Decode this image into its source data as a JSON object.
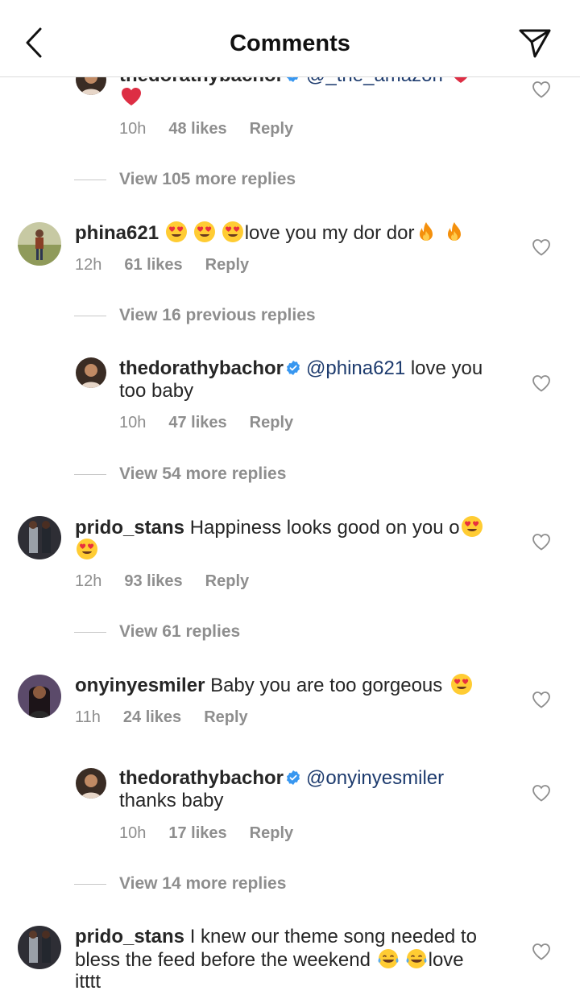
{
  "header": {
    "title": "Comments",
    "back_icon": "chevron-left-icon",
    "send_icon": "paper-plane-icon"
  },
  "comments": [
    {
      "kind": "reply",
      "username": "thedorathybachor",
      "verified": true,
      "mention": "@_the_amazon",
      "text": "",
      "time": "10h",
      "likes": "48 likes",
      "reply": "Reply",
      "emojis": [
        "red-heart"
      ],
      "partially_hidden": true
    },
    {
      "kind": "view",
      "label": "View 105 more replies"
    },
    {
      "kind": "comment",
      "username": "phina621",
      "text": "love you my dor dor",
      "time": "12h",
      "likes": "61 likes",
      "reply": "Reply",
      "emojis_before": [
        "heart-eyes",
        "heart-eyes",
        "heart-eyes"
      ],
      "emojis_after": [
        "fire",
        "fire"
      ]
    },
    {
      "kind": "view",
      "label": "View 16 previous replies"
    },
    {
      "kind": "reply",
      "username": "thedorathybachor",
      "verified": true,
      "mention": "@phina621",
      "text_line1": "love you",
      "text_line2": "too baby",
      "time": "10h",
      "likes": "47 likes",
      "reply": "Reply"
    },
    {
      "kind": "view",
      "label": "View 54 more replies"
    },
    {
      "kind": "comment",
      "username": "prido_stans",
      "text": "Happiness looks good on you o",
      "time": "12h",
      "likes": "93 likes",
      "reply": "Reply",
      "emojis_after": [
        "heart-eyes",
        "heart-eyes"
      ]
    },
    {
      "kind": "view",
      "label": "View 61 replies"
    },
    {
      "kind": "comment",
      "username": "onyinyesmiler",
      "text": "Baby you are too gorgeous",
      "time": "11h",
      "likes": "24 likes",
      "reply": "Reply",
      "emojis_after": [
        "heart-eyes"
      ]
    },
    {
      "kind": "reply",
      "username": "thedorathybachor",
      "verified": true,
      "mention": "@onyinyesmiler",
      "text": "thanks baby",
      "time": "10h",
      "likes": "17 likes",
      "reply": "Reply"
    },
    {
      "kind": "view",
      "label": "View 14 more replies"
    },
    {
      "kind": "comment",
      "username": "prido_stans",
      "text_line1": "I knew our theme song needed to",
      "text_line2": "bless the feed before the weekend",
      "text_after_emoji": "love",
      "text_line3": "itttt",
      "emojis_inline": [
        "tears-of-joy",
        "tears-of-joy"
      ]
    }
  ],
  "colors": {
    "text": "#262626",
    "meta": "#8e8e8e",
    "mention": "#1d3b6e",
    "verified": "#3897f0",
    "divider": "#dbdbdb"
  }
}
